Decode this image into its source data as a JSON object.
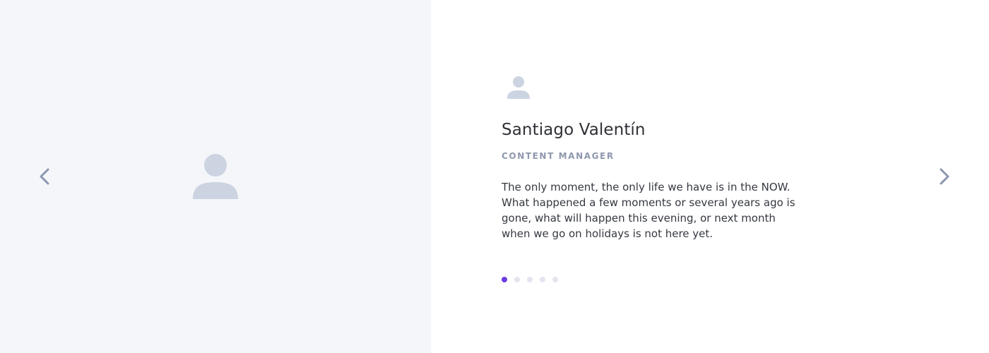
{
  "testimonial": {
    "name": "Santiago Valentín",
    "role": "CONTENT MANAGER",
    "quote": "The only moment, the only life we have is in the NOW. What happened a few moments or several years ago is gone, what will happen this evening, or next month when we go on holidays is not here yet."
  },
  "pagination": {
    "count": 5,
    "active_index": 0
  },
  "icons": {
    "image_placeholder": "user-silhouette-icon",
    "avatar": "user-silhouette-icon",
    "prev": "chevron-left-icon",
    "next": "chevron-right-icon"
  },
  "colors": {
    "image_pane_bg": "#f5f6fa",
    "placeholder_icon": "#ccd3e1",
    "accent": "#6c3be4",
    "dot_inactive": "#e3e5ee",
    "arrow": "#8b96b0",
    "name_text": "#2f3137",
    "role_text": "#8f97ad"
  }
}
